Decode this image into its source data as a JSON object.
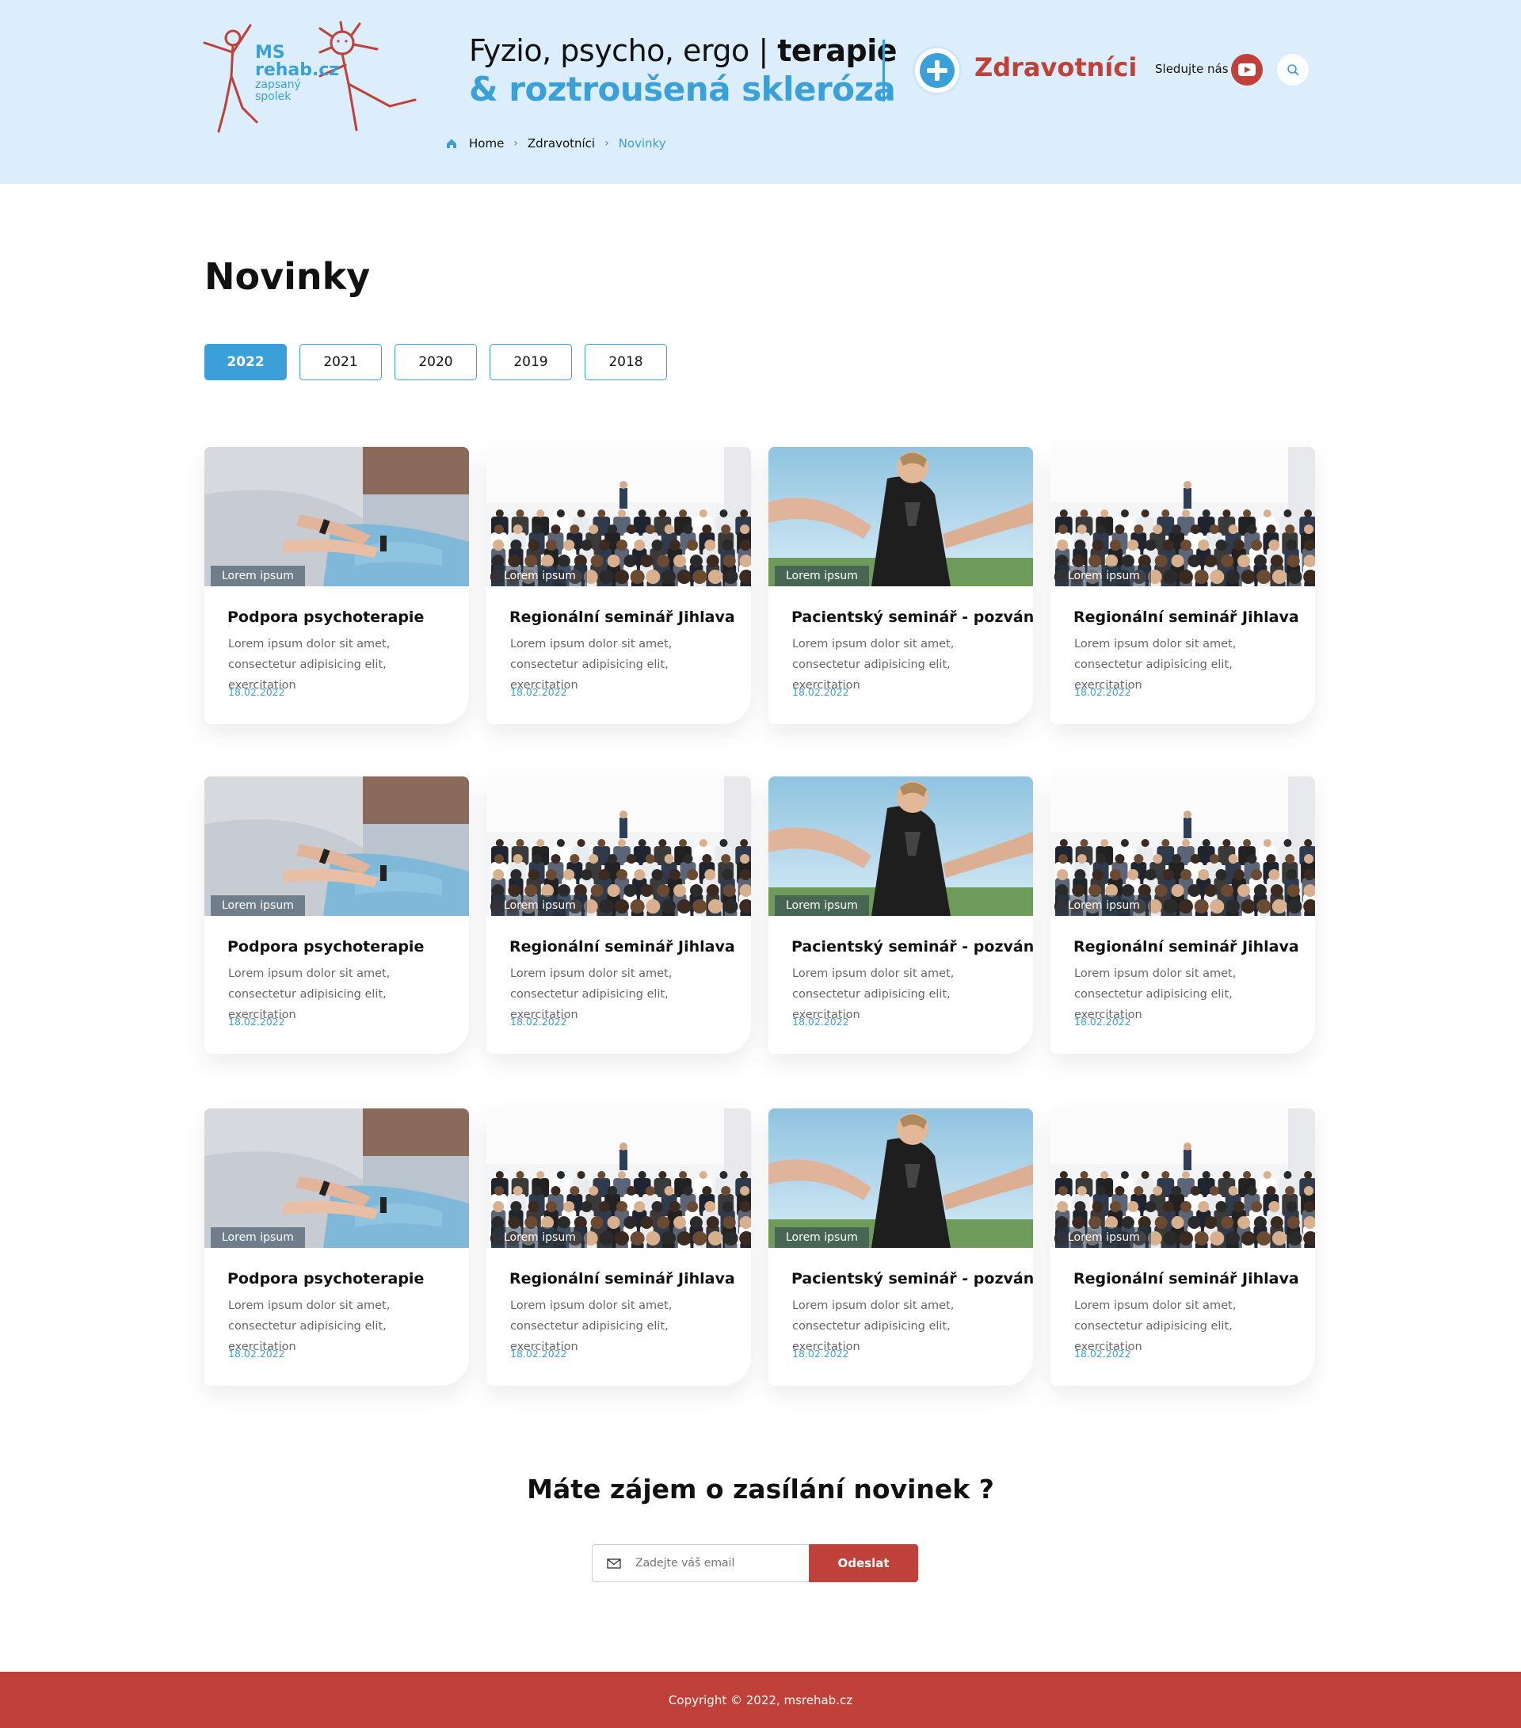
{
  "header": {
    "logo": {
      "line1": "MS",
      "line2": "rehab.cz",
      "sub1": "zapsaný",
      "sub2": "spolek"
    },
    "tagline": {
      "part1": "Fyzio, psycho, ergo | ",
      "part1_bold": "terapie",
      "part2": "& roztroušená skleróza"
    },
    "section_label": "Zdravotníci",
    "follow_label": "Sledujte nás"
  },
  "breadcrumb": {
    "home": "Home",
    "section": "Zdravotníci",
    "current": "Novinky"
  },
  "page_title": "Novinky",
  "years": [
    "2022",
    "2021",
    "2020",
    "2019",
    "2018"
  ],
  "active_year": "2022",
  "cards": [
    {
      "tag": "Lorem ipsum",
      "title": "Podpora psychoterapie",
      "desc": "Lorem ipsum dolor sit amet, consectetur adipisicing elit, exercitation",
      "date": "18.02.2022",
      "image": "hands"
    },
    {
      "tag": "Lorem ipsum",
      "title": "Regionální seminář Jihlava",
      "desc": "Lorem ipsum dolor sit amet, consectetur adipisicing elit, exercitation",
      "date": "18.02.2022",
      "image": "seminar"
    },
    {
      "tag": "Lorem ipsum",
      "title": "Pacientský seminář - pozvánka",
      "desc": "Lorem ipsum dolor sit amet, consectetur adipisicing elit, exercitation",
      "date": "18.02.2022",
      "image": "outdoor"
    },
    {
      "tag": "Lorem ipsum",
      "title": "Regionální seminář Jihlava",
      "desc": "Lorem ipsum dolor sit amet, consectetur adipisicing elit, exercitation",
      "date": "18.02.2022",
      "image": "seminar"
    },
    {
      "tag": "Lorem ipsum",
      "title": "Podpora psychoterapie",
      "desc": "Lorem ipsum dolor sit amet, consectetur adipisicing elit, exercitation",
      "date": "18.02.2022",
      "image": "hands"
    },
    {
      "tag": "Lorem ipsum",
      "title": "Regionální seminář Jihlava",
      "desc": "Lorem ipsum dolor sit amet, consectetur adipisicing elit, exercitation",
      "date": "18.02.2022",
      "image": "seminar"
    },
    {
      "tag": "Lorem ipsum",
      "title": "Pacientský seminář - pozvánka",
      "desc": "Lorem ipsum dolor sit amet, consectetur adipisicing elit, exercitation",
      "date": "18.02.2022",
      "image": "outdoor"
    },
    {
      "tag": "Lorem ipsum",
      "title": "Regionální seminář Jihlava",
      "desc": "Lorem ipsum dolor sit amet, consectetur adipisicing elit, exercitation",
      "date": "18.02.2022",
      "image": "seminar"
    },
    {
      "tag": "Lorem ipsum",
      "title": "Podpora psychoterapie",
      "desc": "Lorem ipsum dolor sit amet, consectetur adipisicing elit, exercitation",
      "date": "18.02.2022",
      "image": "hands"
    },
    {
      "tag": "Lorem ipsum",
      "title": "Regionální seminář Jihlava",
      "desc": "Lorem ipsum dolor sit amet, consectetur adipisicing elit, exercitation",
      "date": "18.02.2022",
      "image": "seminar"
    },
    {
      "tag": "Lorem ipsum",
      "title": "Pacientský seminář - pozvánka",
      "desc": "Lorem ipsum dolor sit amet, consectetur adipisicing elit, exercitation",
      "date": "18.02.2022",
      "image": "outdoor"
    },
    {
      "tag": "Lorem ipsum",
      "title": "Regionální seminář Jihlava",
      "desc": "Lorem ipsum dolor sit amet, consectetur adipisicing elit, exercitation",
      "date": "18.02.2022",
      "image": "seminar"
    }
  ],
  "newsletter": {
    "title": "Máte zájem o zasílání novinek ?",
    "placeholder": "Zadejte váš email",
    "button": "Odeslat"
  },
  "footer": {
    "copyright": "Copyright © 2022, msrehab.cz"
  },
  "colors": {
    "accent_blue": "#3ba0d8",
    "accent_red": "#c0403a",
    "header_bg": "#dcedfb"
  },
  "icons": {
    "home": "home-icon",
    "youtube": "youtube-icon",
    "search": "search-icon",
    "mail": "mail-icon",
    "plus": "plus-circle-icon"
  }
}
